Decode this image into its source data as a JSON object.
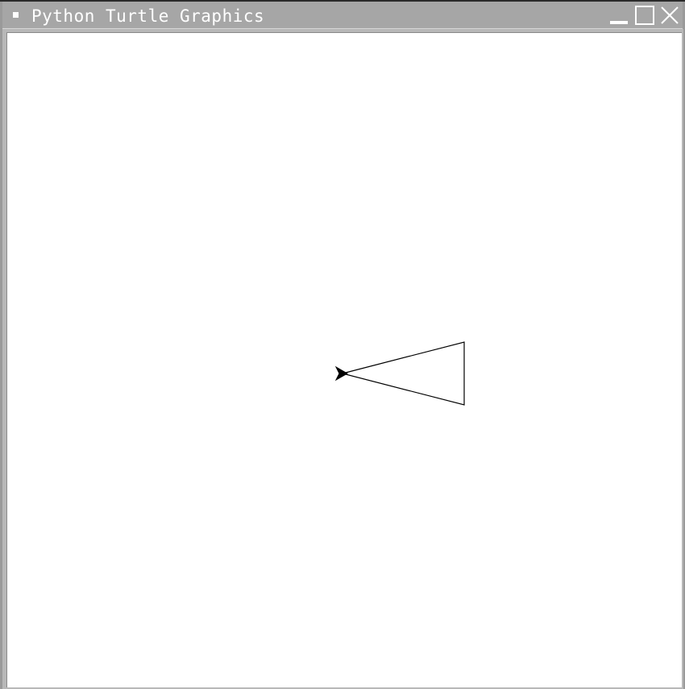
{
  "window": {
    "title": "Python Turtle Graphics",
    "buttons": {
      "minimize_icon": "minimize-icon",
      "maximize_icon": "maximize-icon",
      "close_icon": "close-icon"
    }
  },
  "canvas": {
    "background": "#ffffff",
    "pen_color": "#000000",
    "turtle_shape": "classic-arrow",
    "turtle_heading": "west"
  }
}
